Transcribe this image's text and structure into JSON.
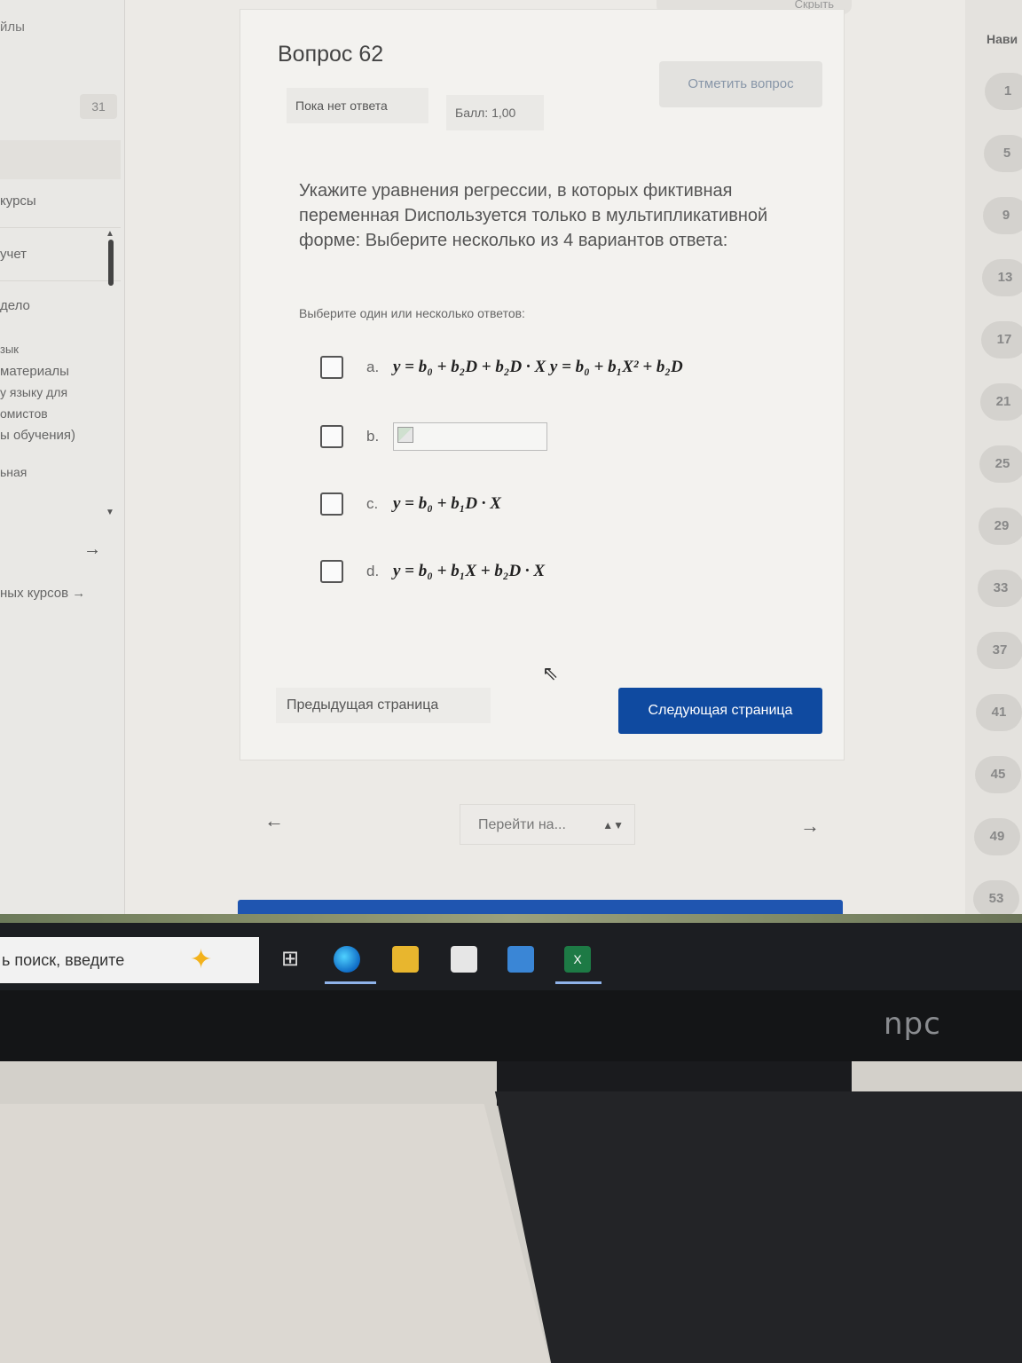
{
  "top_fragment": "Скрыть",
  "sidebar": {
    "top_label": "йлы",
    "badge": "31",
    "items": [
      "курсы",
      "учет",
      "дело",
      "зык",
      "материалы",
      "у языку для",
      "омистов",
      "ы обучения)",
      "ьная"
    ],
    "footer_link": "ных курсов →"
  },
  "question": {
    "title": "Вопрос 62",
    "flag_label": "Отметить вопрос",
    "status": "Пока нет ответа",
    "grade": "Балл: 1,00",
    "text": "Укажите уравнения регрессии, в которых фиктивная переменная Dиспользуется только в мультипликативной форме: Выберите несколько из 4 вариантов ответа:",
    "prompt": "Выберите один или несколько ответов:",
    "options": [
      {
        "letter": "a.",
        "formula": "y = b₀ + b₂D + b₂D · X  y = b₀ + b₁X² + b₂D"
      },
      {
        "letter": "b.",
        "formula": ""
      },
      {
        "letter": "c.",
        "formula": "y = b₀ + b₁D · X"
      },
      {
        "letter": "d.",
        "formula": "y = b₀ + b₁X + b₂D · X"
      }
    ]
  },
  "navigation": {
    "prev_label": "Предыдущая страница",
    "next_label": "Следующая страница",
    "jump_placeholder": "Перейти на...",
    "left_arrow": "←",
    "right_arrow": "→"
  },
  "quiz_nav": {
    "title": "Нави",
    "numbers": [
      "1",
      "5",
      "9",
      "13",
      "17",
      "21",
      "25",
      "29",
      "33",
      "37",
      "41",
      "45",
      "49",
      "53"
    ]
  },
  "taskbar": {
    "search_text": "ь поиск, введите"
  },
  "monitor_brand": "npc",
  "colors": {
    "primary_button": "#0f4aa0",
    "accent_bar": "#1f55b0"
  }
}
